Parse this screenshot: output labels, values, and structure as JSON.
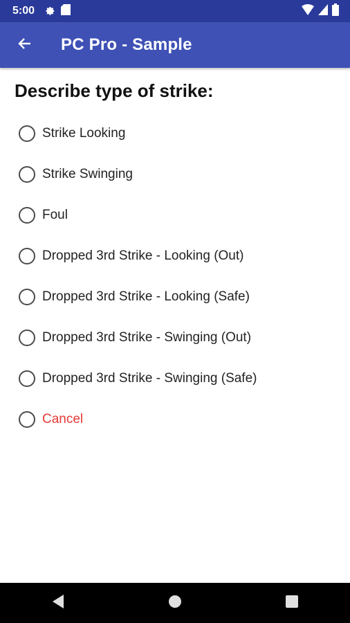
{
  "status_bar": {
    "time": "5:00",
    "icons_left": [
      "settings-icon",
      "sd-card-icon"
    ],
    "icons_right": [
      "wifi-icon",
      "cell-signal-icon",
      "battery-icon"
    ]
  },
  "app_bar": {
    "title": "PC Pro - Sample",
    "back_icon": "arrow-back-icon",
    "color": "#3f51b5"
  },
  "question": "Describe type of strike:",
  "options": [
    {
      "label": "Strike Looking",
      "selected": false
    },
    {
      "label": "Strike Swinging",
      "selected": false
    },
    {
      "label": "Foul",
      "selected": false
    },
    {
      "label": "Dropped 3rd Strike - Looking (Out)",
      "selected": false
    },
    {
      "label": "Dropped 3rd Strike - Looking (Safe)",
      "selected": false
    },
    {
      "label": "Dropped 3rd Strike - Swinging (Out)",
      "selected": false
    },
    {
      "label": "Dropped 3rd Strike - Swinging (Safe)",
      "selected": false
    },
    {
      "label": "Cancel",
      "selected": false,
      "color": "#e53935"
    }
  ],
  "nav_bar": {
    "buttons": [
      "back-triangle-icon",
      "home-circle-icon",
      "recents-square-icon"
    ]
  }
}
